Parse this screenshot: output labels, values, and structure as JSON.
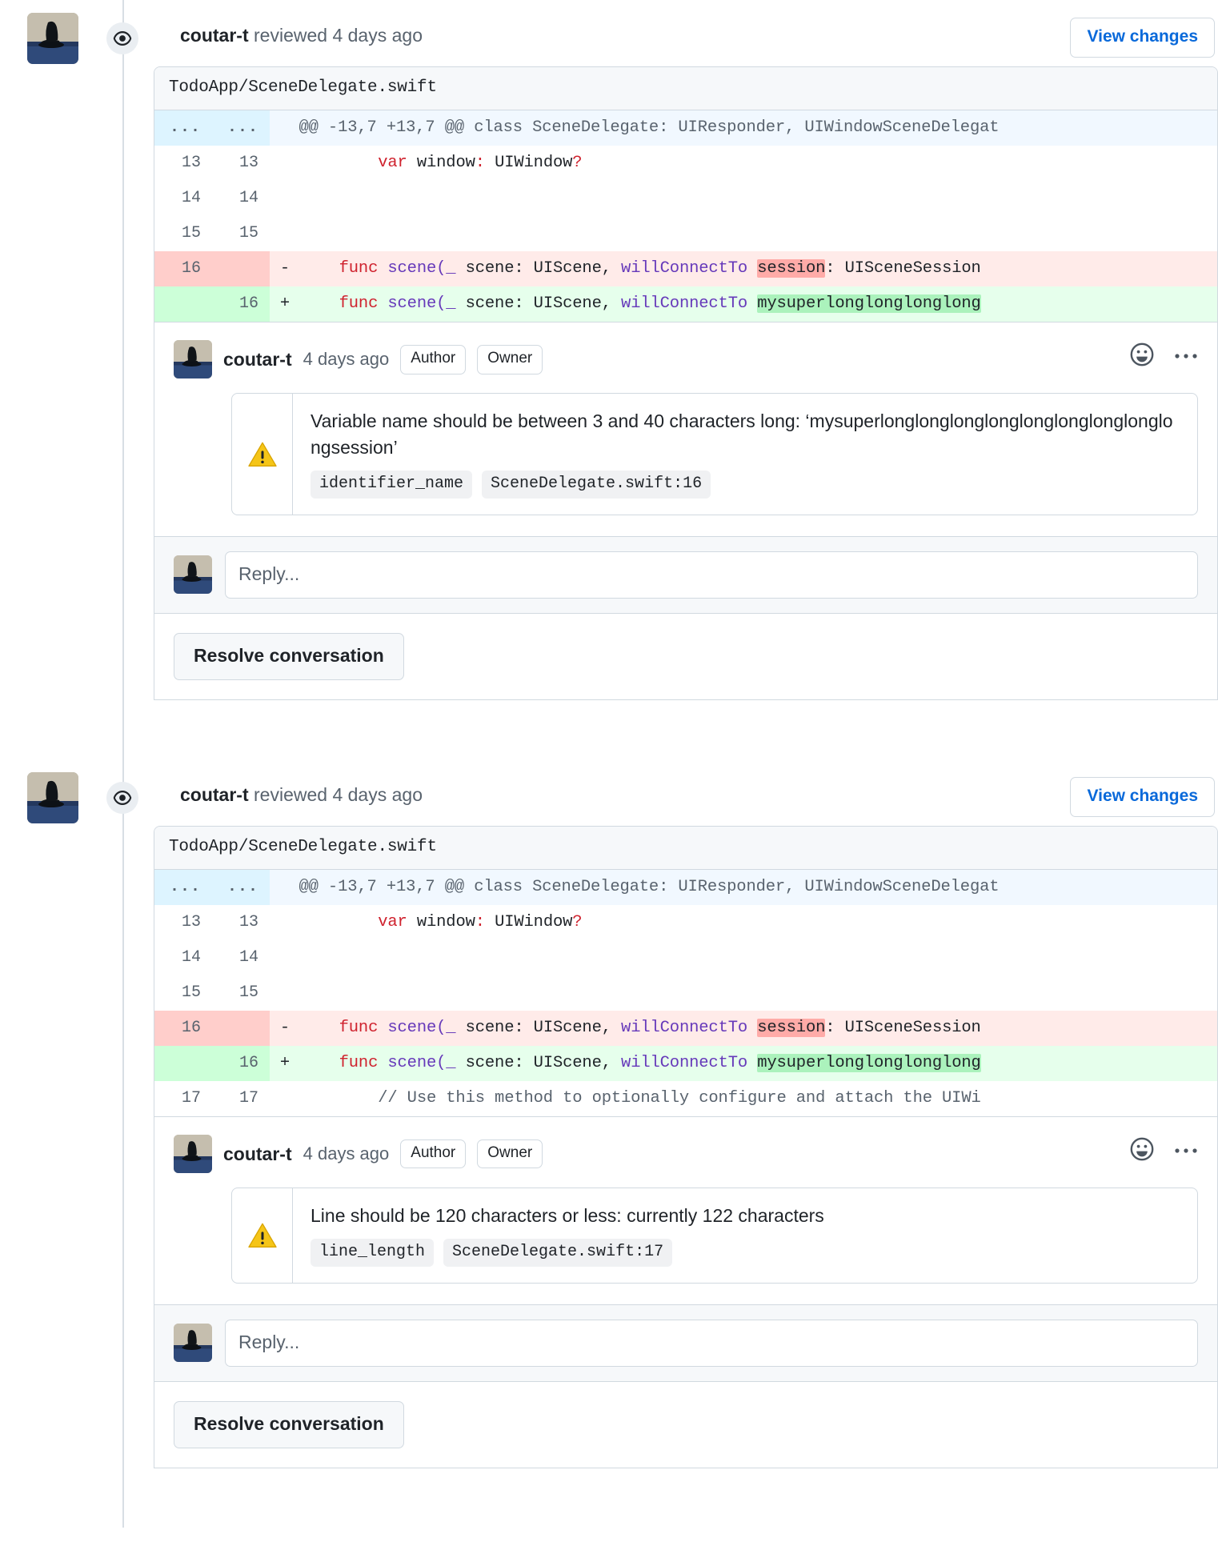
{
  "theme": {
    "accent_link": "#0969da",
    "border": "#d1d9e0",
    "muted_text": "#59636e",
    "diff_add_bg": "#e6ffec",
    "diff_del_bg": "#ffebe9",
    "diff_add_word": "#abf2bc",
    "diff_del_word": "#ffaba8",
    "hunk_bg": "#f1f8ff",
    "warning_yellow": "#f5c518"
  },
  "icons": {
    "eye": "eye-icon",
    "warning": "warning-triangle-icon",
    "emoji": "smiley-reaction-icon",
    "kebab": "kebab-horizontal-icon"
  },
  "reviews": [
    {
      "id": "review-1",
      "author": "coutar-t",
      "action": "reviewed 4 days ago",
      "view_changes_label": "View changes",
      "file": "TodoApp/SceneDelegate.swift",
      "hunk": {
        "old_ln": "...",
        "new_ln": "...",
        "header": "@@ -13,7 +13,7 @@ class SceneDelegate: UIResponder, UIWindowSceneDelegat"
      },
      "lines": [
        {
          "type": "ctx",
          "old": "13",
          "new": "13",
          "marker": "",
          "segments": [
            {
              "t": "        ",
              "c": ""
            },
            {
              "t": "var",
              "c": "kw"
            },
            {
              "t": " window",
              "c": ""
            },
            {
              "t": ":",
              "c": "kw"
            },
            {
              "t": " UIWindow",
              "c": ""
            },
            {
              "t": "?",
              "c": "kw"
            }
          ]
        },
        {
          "type": "ctx",
          "old": "14",
          "new": "14",
          "marker": "",
          "segments": []
        },
        {
          "type": "ctx",
          "old": "15",
          "new": "15",
          "marker": "",
          "segments": []
        },
        {
          "type": "del",
          "old": "16",
          "new": "",
          "marker": "-",
          "segments": [
            {
              "t": "    ",
              "c": ""
            },
            {
              "t": "func",
              "c": "kw"
            },
            {
              "t": " ",
              "c": ""
            },
            {
              "t": "scene",
              "c": "fn"
            },
            {
              "t": "(",
              "c": "fn"
            },
            {
              "t": "_",
              "c": "pm"
            },
            {
              "t": " scene: UIScene, ",
              "c": ""
            },
            {
              "t": "willConnectTo",
              "c": "fn"
            },
            {
              "t": " ",
              "c": ""
            },
            {
              "t": "session",
              "c": "hl-del"
            },
            {
              "t": ": UISceneSession",
              "c": ""
            }
          ]
        },
        {
          "type": "add",
          "old": "",
          "new": "16",
          "marker": "+",
          "segments": [
            {
              "t": "    ",
              "c": ""
            },
            {
              "t": "func",
              "c": "kw"
            },
            {
              "t": " ",
              "c": ""
            },
            {
              "t": "scene",
              "c": "fn"
            },
            {
              "t": "(",
              "c": "fn"
            },
            {
              "t": "_",
              "c": "pm"
            },
            {
              "t": " scene: UIScene, ",
              "c": ""
            },
            {
              "t": "willConnectTo",
              "c": "fn"
            },
            {
              "t": " ",
              "c": ""
            },
            {
              "t": "mysuperlonglonglonglong",
              "c": "hl-add"
            }
          ]
        }
      ],
      "comment": {
        "author": "coutar-t",
        "time": "4 days ago",
        "badges": [
          "Author",
          "Owner"
        ],
        "annotation_text": "Variable name should be between 3 and 40 characters long: ‘mysuperlonglonglonglonglonglonglonglonglongsession’",
        "tags": [
          "identifier_name",
          "SceneDelegate.swift:16"
        ]
      },
      "reply_placeholder": "Reply...",
      "resolve_label": "Resolve conversation"
    },
    {
      "id": "review-2",
      "author": "coutar-t",
      "action": "reviewed 4 days ago",
      "view_changes_label": "View changes",
      "file": "TodoApp/SceneDelegate.swift",
      "hunk": {
        "old_ln": "...",
        "new_ln": "...",
        "header": "@@ -13,7 +13,7 @@ class SceneDelegate: UIResponder, UIWindowSceneDelegat"
      },
      "lines": [
        {
          "type": "ctx",
          "old": "13",
          "new": "13",
          "marker": "",
          "segments": [
            {
              "t": "        ",
              "c": ""
            },
            {
              "t": "var",
              "c": "kw"
            },
            {
              "t": " window",
              "c": ""
            },
            {
              "t": ":",
              "c": "kw"
            },
            {
              "t": " UIWindow",
              "c": ""
            },
            {
              "t": "?",
              "c": "kw"
            }
          ]
        },
        {
          "type": "ctx",
          "old": "14",
          "new": "14",
          "marker": "",
          "segments": []
        },
        {
          "type": "ctx",
          "old": "15",
          "new": "15",
          "marker": "",
          "segments": []
        },
        {
          "type": "del",
          "old": "16",
          "new": "",
          "marker": "-",
          "segments": [
            {
              "t": "    ",
              "c": ""
            },
            {
              "t": "func",
              "c": "kw"
            },
            {
              "t": " ",
              "c": ""
            },
            {
              "t": "scene",
              "c": "fn"
            },
            {
              "t": "(",
              "c": "fn"
            },
            {
              "t": "_",
              "c": "pm"
            },
            {
              "t": " scene: UIScene, ",
              "c": ""
            },
            {
              "t": "willConnectTo",
              "c": "fn"
            },
            {
              "t": " ",
              "c": ""
            },
            {
              "t": "session",
              "c": "hl-del"
            },
            {
              "t": ": UISceneSession",
              "c": ""
            }
          ]
        },
        {
          "type": "add",
          "old": "",
          "new": "16",
          "marker": "+",
          "segments": [
            {
              "t": "    ",
              "c": ""
            },
            {
              "t": "func",
              "c": "kw"
            },
            {
              "t": " ",
              "c": ""
            },
            {
              "t": "scene",
              "c": "fn"
            },
            {
              "t": "(",
              "c": "fn"
            },
            {
              "t": "_",
              "c": "pm"
            },
            {
              "t": " scene: UIScene, ",
              "c": ""
            },
            {
              "t": "willConnectTo",
              "c": "fn"
            },
            {
              "t": " ",
              "c": ""
            },
            {
              "t": "mysuperlonglonglonglong",
              "c": "hl-add"
            }
          ]
        },
        {
          "type": "ctx",
          "old": "17",
          "new": "17",
          "marker": "",
          "segments": [
            {
              "t": "        ",
              "c": ""
            },
            {
              "t": "// Use this method to optionally configure and attach the UIWi",
              "c": "cmt"
            }
          ]
        }
      ],
      "comment": {
        "author": "coutar-t",
        "time": "4 days ago",
        "badges": [
          "Author",
          "Owner"
        ],
        "annotation_text": "Line should be 120 characters or less: currently 122 characters",
        "tags": [
          "line_length",
          "SceneDelegate.swift:17"
        ]
      },
      "reply_placeholder": "Reply...",
      "resolve_label": "Resolve conversation"
    }
  ]
}
